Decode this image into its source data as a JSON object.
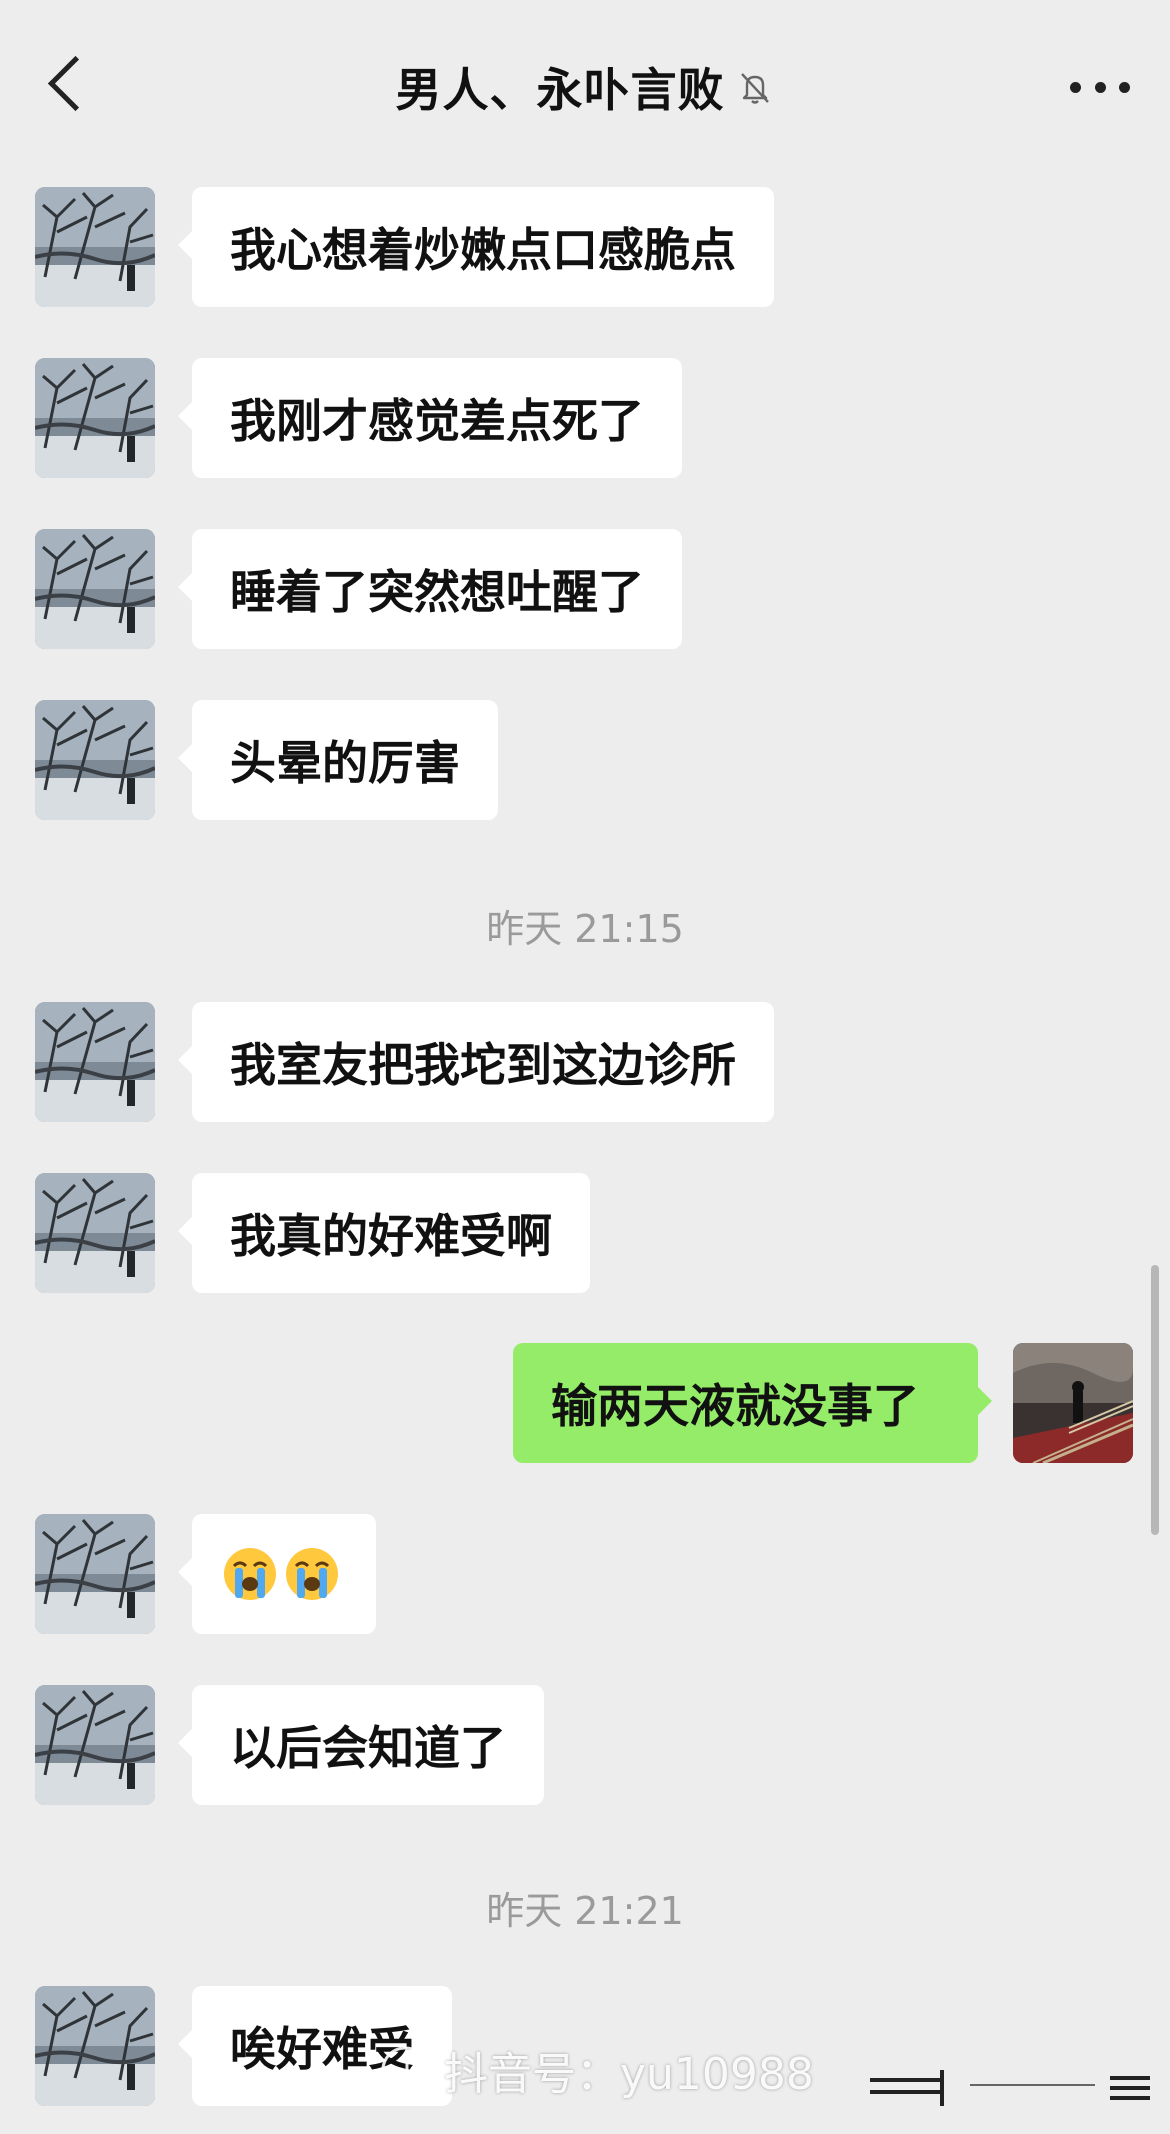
{
  "header": {
    "title": "男人、永卟言败",
    "back_icon": "chevron-left-icon",
    "mute_icon": "bell-slash-icon",
    "more_icon": "more-horizontal-icon"
  },
  "messages": [
    {
      "type": "in",
      "text": "我心想着炒嫩点口感脆点"
    },
    {
      "type": "in",
      "text": "我刚才感觉差点死了"
    },
    {
      "type": "in",
      "text": "睡着了突然想吐醒了"
    },
    {
      "type": "in",
      "text": "头晕的厉害"
    },
    {
      "type": "time",
      "text": "昨天 21:15"
    },
    {
      "type": "in",
      "text": "我室友把我坨到这边诊所"
    },
    {
      "type": "in",
      "text": "我真的好难受啊"
    },
    {
      "type": "out",
      "text": "输两天液就没事了"
    },
    {
      "type": "in",
      "text": "",
      "emoji": [
        "loudly-crying-face-emoji",
        "loudly-crying-face-emoji"
      ]
    },
    {
      "type": "in",
      "text": "以后会知道了"
    },
    {
      "type": "time",
      "text": "昨天 21:21"
    },
    {
      "type": "in",
      "text": "唉好难受"
    }
  ],
  "watermark": {
    "text": "抖音号：yu10988",
    "icon": "douyin-logo-icon"
  },
  "colors": {
    "background": "#ededed",
    "incoming_bubble": "#ffffff",
    "outgoing_bubble": "#95ec69",
    "timestamp_text": "#9a9a9a"
  }
}
